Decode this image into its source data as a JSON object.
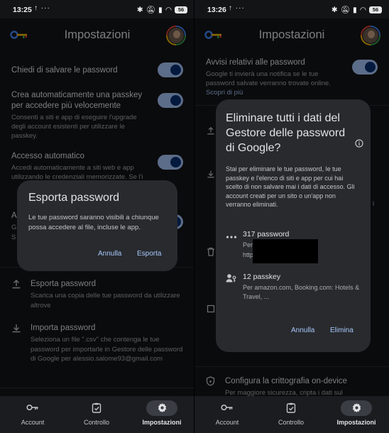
{
  "left": {
    "status": {
      "time": "13:25",
      "dots": "↑ ···",
      "battery": "56"
    },
    "appbar": {
      "title": "Impostazioni"
    },
    "settings": [
      {
        "title": "Chiedi di salvare le password"
      },
      {
        "title": "Crea automaticamente una passkey per accedere più velocemente",
        "subtitle": "Consenti a siti e app di eseguire l'upgrade degli account esistenti per utilizzare le passkey."
      },
      {
        "title": "Accesso automatico",
        "subtitle": "Accedi automaticamente a siti web e app utilizzando le credenziali memorizzate. Se l'i"
      }
    ],
    "partial_rows": {
      "a": "A",
      "g": "G",
      "s": "S"
    },
    "dialog": {
      "title": "Esporta password",
      "body": "Le tue password saranno visibili a chiunque possa accedere al file, incluse le app.",
      "cancel": "Annulla",
      "confirm": "Esporta"
    },
    "export": {
      "title": "Esporta password",
      "subtitle": "Scarica una copia delle tue password da utilizzare altrove"
    },
    "import": {
      "title": "Importa password",
      "subtitle": "Seleziona un file \".csv\" che contenga le tue password per importarle in Gestore delle password di Google per alessio.salome93@gmail.com"
    }
  },
  "right": {
    "status": {
      "time": "13:26",
      "dots": "↑ ···",
      "battery": "56"
    },
    "appbar": {
      "title": "Impostazioni"
    },
    "alerts": {
      "title": "Avvisi relativi alle password",
      "subtitle": "Google ti invierà una notifica se le tue password salvate verranno trovate online.",
      "link": "Scopri di più"
    },
    "dialog": {
      "title": "Eliminare tutti i dati del Gestore delle password di Google?",
      "body": "Stai per eliminare le tue password, le tue passkey e l'elenco di siti e app per cui hai scelto di non salvare mai i dati di accesso. Gli account creati per un sito o un'app non verranno eliminati.",
      "passwords": {
        "count": "317 password",
        "line1": "Per",
        "line2": "http"
      },
      "passkeys": {
        "count": "12 passkey",
        "detail": "Per amazon.com, Booking.com: Hotels & Travel, ..."
      },
      "cancel": "Annulla",
      "confirm": "Elimina"
    },
    "partial_rows": {
      "l": "l"
    },
    "crypto": {
      "title": "Configura la crittografia on-device",
      "subtitle": "Per maggiore sicurezza, cripta i dati sul"
    }
  },
  "nav": [
    {
      "label": "Account"
    },
    {
      "label": "Controllo"
    },
    {
      "label": "Impostazioni"
    }
  ],
  "colors": {
    "accent": "#a8c7fa",
    "toggle_knob": "#062e6f",
    "background": "#131416",
    "dialog": "#282a2e"
  }
}
